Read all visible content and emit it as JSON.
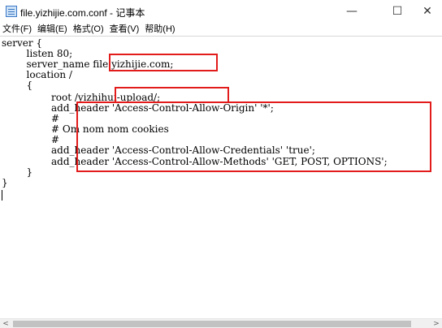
{
  "window": {
    "title": "file.yizhijie.com.conf - 记事本",
    "minimize_glyph": "—",
    "maximize_glyph": "☐",
    "close_glyph": "✕"
  },
  "menu": {
    "items": [
      "文件(F)",
      "编辑(E)",
      "格式(O)",
      "查看(V)",
      "帮助(H)"
    ]
  },
  "editor": {
    "lines": [
      "server {",
      "        listen 80;",
      "        server_name file.yizhijie.com;",
      "        location /",
      "        {",
      "                root /yizhihui-upload/;",
      "                add_header 'Access-Control-Allow-Origin' '*';",
      "                #",
      "                # Om nom nom cookies",
      "                #",
      "                add_header 'Access-Control-Allow-Credentials' 'true';",
      "                add_header 'Access-Control-Allow-Methods' 'GET, POST, OPTIONS';",
      "        }",
      "}"
    ]
  },
  "scrollbar": {
    "left_arrow": "<",
    "right_arrow": ">"
  },
  "colors": {
    "highlight": "#e21b1b",
    "text": "#000000",
    "background": "#ffffff"
  }
}
